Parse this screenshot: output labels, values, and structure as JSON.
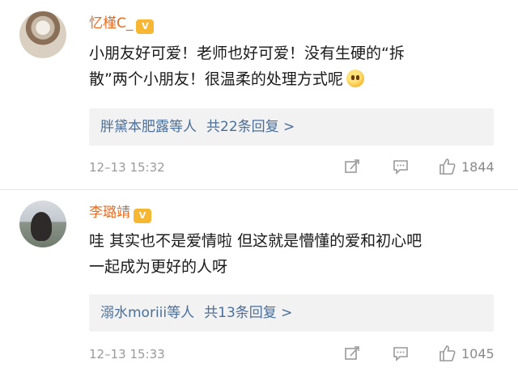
{
  "comments": [
    {
      "username": "忆槿C_",
      "vip": "V",
      "text_line1": "小朋友好可爱！老师也好可爱！没有生硬的“拆",
      "text_line2": "散”两个小朋友！很温柔的处理方式呢",
      "emoji": "smiling-face-emoji",
      "replies_text": "胖黛本肥露等人",
      "replies_count": "共22条回复 >",
      "time": "12–13 15:32",
      "likes": "1844"
    },
    {
      "username": "李璐靖",
      "vip": "V",
      "text_line1": "哇 其实也不是爱情啦 但这就是懵懂的爱和初心吧",
      "text_line2": "一起成为更好的人呀",
      "replies_text": "溺水moriii等人",
      "replies_count": "共13条回复 >",
      "time": "12–13 15:33",
      "likes": "1045"
    }
  ],
  "colors": {
    "username": "#e86b1f",
    "link": "#4a6f9b",
    "meta": "#9a9a9a"
  }
}
